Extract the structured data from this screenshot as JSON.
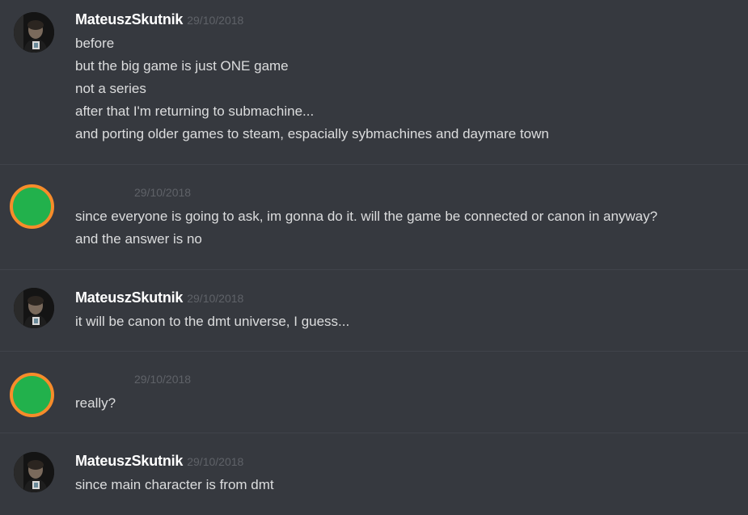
{
  "messages": [
    {
      "username": "MateuszSkutnik",
      "timestamp": "29/10/2018",
      "avatar": "user-photo",
      "lines": [
        "before",
        "but the big game is just ONE game",
        "not a series",
        "after that I'm returning to submachine...",
        "and porting older games to steam, espacially sybmachines and daymare town"
      ]
    },
    {
      "username": "",
      "timestamp": "29/10/2018",
      "avatar": "green-circle",
      "lines": [
        "since everyone is going to ask, im gonna do it. will the game be connected or canon in anyway?",
        "and the answer is no"
      ]
    },
    {
      "username": "MateuszSkutnik",
      "timestamp": "29/10/2018",
      "avatar": "user-photo",
      "lines": [
        "it will be canon to the dmt universe, I guess..."
      ]
    },
    {
      "username": "",
      "timestamp": "29/10/2018",
      "avatar": "green-circle",
      "lines": [
        "really?"
      ]
    },
    {
      "username": "MateuszSkutnik",
      "timestamp": "29/10/2018",
      "avatar": "user-photo",
      "lines": [
        "since main character is from dmt"
      ]
    }
  ],
  "colors": {
    "background": "#36393f",
    "username": "#ffffff",
    "message_text": "#dcddde",
    "timestamp": "#5f6268",
    "divider": "#40434a",
    "avatar_green": "#22b14c",
    "avatar_ring": "#f78c2a"
  }
}
